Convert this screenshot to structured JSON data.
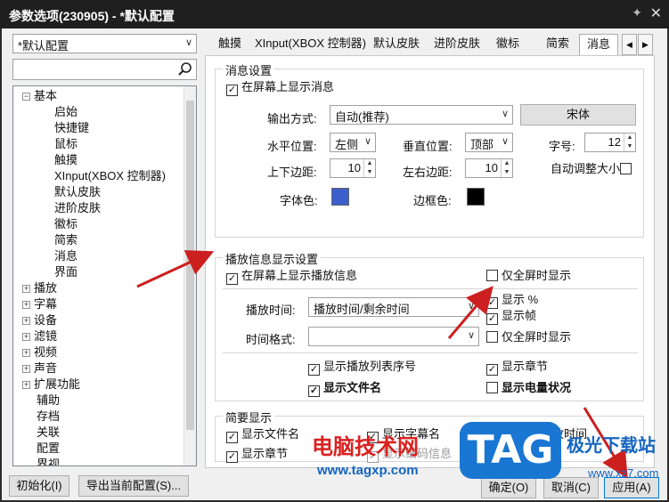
{
  "window": {
    "title": "参数选项(230905) - *默认配置",
    "pin": "✦",
    "close": "✕"
  },
  "profile_combo": "*默认配置",
  "search_placeholder": "",
  "tree": [
    {
      "label": "基本",
      "level": 0,
      "exp": "−"
    },
    {
      "label": "启始",
      "level": 2
    },
    {
      "label": "快捷键",
      "level": 2
    },
    {
      "label": "鼠标",
      "level": 2
    },
    {
      "label": "触摸",
      "level": 2
    },
    {
      "label": "XInput(XBOX 控制器)",
      "level": 2
    },
    {
      "label": "默认皮肤",
      "level": 2
    },
    {
      "label": "进阶皮肤",
      "level": 2
    },
    {
      "label": "徽标",
      "level": 2
    },
    {
      "label": "简索",
      "level": 2
    },
    {
      "label": "消息",
      "level": 2
    },
    {
      "label": "界面",
      "level": 2
    },
    {
      "label": "播放",
      "level": 0,
      "exp": "+"
    },
    {
      "label": "字幕",
      "level": 0,
      "exp": "+"
    },
    {
      "label": "设备",
      "level": 0,
      "exp": "+"
    },
    {
      "label": "滤镜",
      "level": 0,
      "exp": "+"
    },
    {
      "label": "视频",
      "level": 0,
      "exp": "+"
    },
    {
      "label": "声音",
      "level": 0,
      "exp": "+"
    },
    {
      "label": "扩展功能",
      "level": 0,
      "exp": "+"
    },
    {
      "label": "辅助",
      "level": 1
    },
    {
      "label": "存档",
      "level": 1
    },
    {
      "label": "关联",
      "level": 1
    },
    {
      "label": "配置",
      "level": 1
    },
    {
      "label": "界视",
      "level": 1
    }
  ],
  "tabs": [
    "触摸",
    "XInput(XBOX 控制器)",
    "默认皮肤",
    "进阶皮肤",
    "徽标",
    "简索",
    "消息"
  ],
  "tab_scroll": {
    "left": "◀",
    "right": "▶"
  },
  "msg": {
    "group_title": "消息设置",
    "show_on_screen": "在屏幕上显示消息",
    "output_label": "输出方式:",
    "output_value": "自动(推荐)",
    "font_button": "宋体",
    "hpos_label": "水平位置:",
    "hpos_value": "左侧",
    "vpos_label": "垂直位置:",
    "vpos_value": "顶部",
    "size_label": "字号:",
    "size_value": "12",
    "margin_tb_label": "上下边距:",
    "margin_tb_value": "10",
    "margin_lr_label": "左右边距:",
    "margin_lr_value": "10",
    "auto_size": "自动调整大小",
    "font_color_label": "字体色:",
    "border_color_label": "边框色:",
    "font_color": "#3a5fcd",
    "border_color": "#000000"
  },
  "play": {
    "group_title": "播放信息显示设置",
    "show_on_screen": "在屏幕上显示播放信息",
    "fullscreen_only": "仅全屏时显示",
    "time_label": "播放时间:",
    "time_value": "播放时间/剩余时间",
    "show_percent": "显示 %",
    "show_frame": "显示帧",
    "format_label": "时间格式:",
    "format_value": "",
    "fullscreen_only2": "仅全屏时显示",
    "show_playlist_no": "显示播放列表序号",
    "show_chapter": "显示章节",
    "show_filename": "显示文件名",
    "show_battery": "显示电量状况"
  },
  "brief": {
    "group_title": "简要显示",
    "show_filename": "显示文件名",
    "show_subtitle": "显示字幕名",
    "show_playtime": "显示播放时间",
    "show_chapter": "显示章节",
    "show_codec": "显示编码信息"
  },
  "buttons": {
    "init": "初始化(I)",
    "export": "导出当前配置(S)...",
    "ok": "确定(O)",
    "cancel": "取消(C)",
    "apply": "应用(A)"
  },
  "watermark": {
    "cn": "电脑技术网",
    "url": "www.tagxp.com",
    "tag": "TAG",
    "site_cn": "极光下载站",
    "site_url": "www.xz7.com"
  },
  "colors": {
    "arrow": "#cc1f1f",
    "title_bg": "#1f1f1f"
  }
}
